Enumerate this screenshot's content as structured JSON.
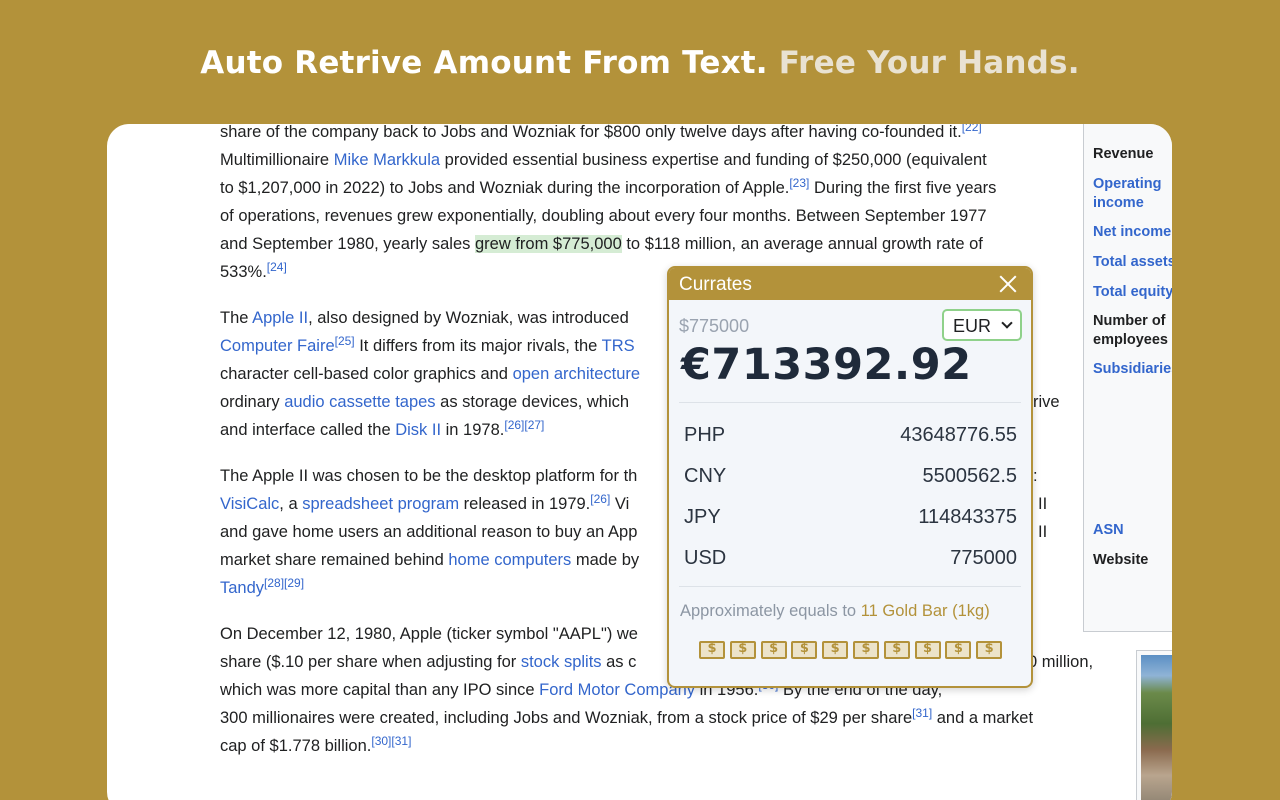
{
  "headline": {
    "part1": "Auto Retrive Amount From Text.",
    "part2": "Free Your Hands."
  },
  "article": {
    "p1": {
      "l0": "share of the company back to Jobs and Wozniak for $800 only twelve days after having co-founded it.",
      "l0_ref": "[22]",
      "l1a": "Multimillionaire ",
      "l1_link": "Mike Markkula",
      "l1b": " provided essential business expertise and funding of $250,000 (equivalent",
      "l2": "to $1,207,000 in 2022) to Jobs and Wozniak during the incorporation of Apple.",
      "l2_ref": "[23]",
      "l2b": " During the first five years",
      "l3": "of operations, revenues grew exponentially, doubling about every four months. Between September 1977",
      "l4a": "and September 1980, yearly sales ",
      "l4_hl": "grew from $775,000",
      "l4b": " to $118 million, an average annual growth rate of",
      "l5": "533%.",
      "l5_ref": "[24]"
    },
    "p2": {
      "l0a": "The ",
      "l0_link": "Apple II",
      "l0b": ", also designed by Wozniak, was introduced",
      "l1_link": "Computer Faire",
      "l1_ref": "[25]",
      "l1b": " It differs from its major rivals, the ",
      "l1_link2": "TRS",
      "l2a": "character cell-based color graphics and ",
      "l2_link": "open architecture",
      "l3a": "ordinary ",
      "l3_link": "audio cassette tapes",
      "l3b": " as storage devices, which",
      "l3c": "rive",
      "l4a": "and interface called the ",
      "l4_link": "Disk II",
      "l4b": " in 1978.",
      "l4_ref": "[26][27]"
    },
    "p3": {
      "l0": "The Apple II was chosen to be the desktop platform for th",
      "l0c": ":",
      "l1_link": "VisiCalc",
      "l1a": ", a ",
      "l1_link2": "spreadsheet program",
      "l1b": " released in 1979.",
      "l1_ref": "[26]",
      "l1c": " Vi",
      "l1d": "II",
      "l2": "and gave home users an additional reason to buy an App",
      "l2c": "II",
      "l3a": "market share remained behind ",
      "l3_link": "home computers",
      "l3b": " made by",
      "l4_link": "Tandy",
      "l4_ref": "[28][29]"
    },
    "p4": {
      "l0": "On December 12, 1980, Apple (ticker symbol \"AAPL\") we",
      "l1a": "share ($.10 per share when adjusting for ",
      "l1_link": "stock splits",
      "l1b": " as c",
      "l1c": "0 million,",
      "l2a": "which was more capital than any IPO since ",
      "l2_link": "Ford Motor Company",
      "l2b": " in 1956.",
      "l2_ref": "[30]",
      "l2c": " By the end of the day,",
      "l3a": "300 millionaires were created, including Jobs and Wozniak, from a stock price of $29 per share",
      "l3_ref": "[31]",
      "l3b": " and a market",
      "l4": "cap of $1.778 billion.",
      "l4_ref": "[30][31]"
    }
  },
  "infobox": {
    "revenue": "Revenue",
    "operating_income": "Operating income",
    "net_income": "Net income",
    "total_assets": "Total assets",
    "total_equity": "Total equity",
    "employees": "Number of employees",
    "subsidiaries": "Subsidiaries",
    "asn": "ASN",
    "website": "Website"
  },
  "popup": {
    "title": "Currates",
    "source_amount": "$775000",
    "selected_currency": "EUR",
    "converted": "€713392.92",
    "rates": [
      {
        "code": "PHP",
        "value": "43648776.55"
      },
      {
        "code": "CNY",
        "value": "5500562.5"
      },
      {
        "code": "JPY",
        "value": "114843375"
      },
      {
        "code": "USD",
        "value": "775000"
      }
    ],
    "approx_label": "Approximately equals to ",
    "approx_value": "11 Gold Bar (1kg)",
    "gold_bar_count": 10,
    "colors": {
      "accent": "#b3923a",
      "link": "#3366cc",
      "highlight": "#d5ecd4"
    }
  }
}
